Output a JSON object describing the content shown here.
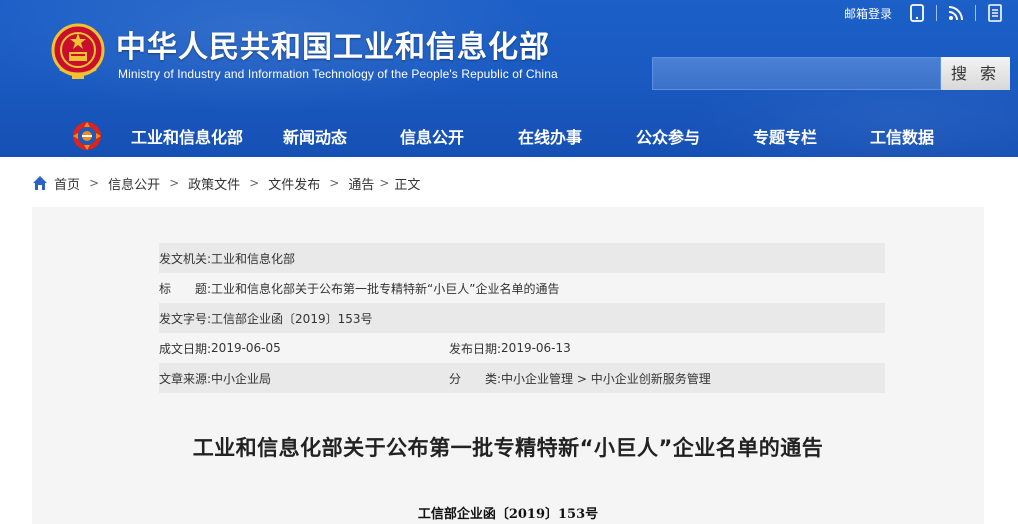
{
  "header": {
    "title": "中华人民共和国工业和信息化部",
    "subtitle": "Ministry of Industry and Information Technology of the People's Republic of China",
    "mail_login": "邮箱登录",
    "search_button": "搜 索",
    "search_placeholder": "",
    "colors": {
      "header_bg": "#1a5bc3",
      "text": "#ffffff"
    }
  },
  "nav": {
    "items": [
      {
        "label": "工业和信息化部"
      },
      {
        "label": "新闻动态"
      },
      {
        "label": "信息公开"
      },
      {
        "label": "在线办事"
      },
      {
        "label": "公众参与"
      },
      {
        "label": "专题专栏"
      },
      {
        "label": "工信数据"
      }
    ]
  },
  "breadcrumb": {
    "items": [
      "首页",
      "信息公开",
      "政策文件",
      "文件发布",
      "通告",
      "正文"
    ],
    "separator": ">"
  },
  "meta": {
    "issuer_label": "发文机关:",
    "issuer": "工业和信息化部",
    "title_label": "标　　题:",
    "title": "工业和信息化部关于公布第一批专精特新“小巨人”企业名单的通告",
    "doc_no_label": "发文字号:",
    "doc_no": "工信部企业函〔2019〕153号",
    "created_label": "成文日期:",
    "created": "2019-06-05",
    "published_label": "发布日期:",
    "published": "2019-06-13",
    "source_label": "文章来源:",
    "source": "中小企业局",
    "category_label": "分　　类:",
    "category": "中小企业管理 > 中小企业创新服务管理"
  },
  "document": {
    "title": "工业和信息化部关于公布第一批专精特新“小巨人”企业名单的通告",
    "number": "工信部企业函〔2019〕153号"
  },
  "icons": {
    "emblem": "national-emblem-icon",
    "mobile": "mobile-icon",
    "rss": "rss-icon",
    "weibo": "weibo-icon",
    "home": "home-icon",
    "nav_logo": "miit-logo-icon"
  }
}
